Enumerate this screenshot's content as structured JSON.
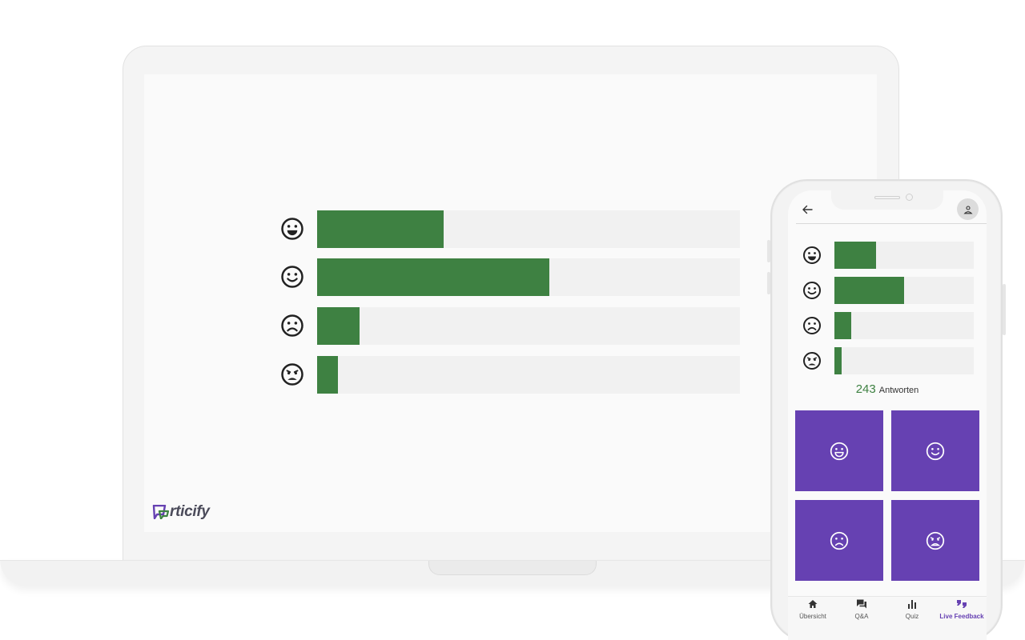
{
  "laptop": {
    "brand": {
      "text": "rticify",
      "mark_color": "#6641b2",
      "accent_color": "#3e8142"
    },
    "feedback": [
      {
        "mood": "very-happy",
        "icon": "laughing-face-icon",
        "fraction": 0.3
      },
      {
        "mood": "happy",
        "icon": "smiling-face-icon",
        "fraction": 0.55
      },
      {
        "mood": "sad",
        "icon": "frowning-face-icon",
        "fraction": 0.1
      },
      {
        "mood": "very-sad",
        "icon": "angry-face-icon",
        "fraction": 0.05
      }
    ]
  },
  "phone": {
    "topbar": {
      "back_icon": "arrow-left-icon",
      "avatar_icon": "person-icon"
    },
    "feedback": [
      {
        "mood": "very-happy",
        "icon": "laughing-face-icon",
        "fraction": 0.3
      },
      {
        "mood": "happy",
        "icon": "smiling-face-icon",
        "fraction": 0.5
      },
      {
        "mood": "sad",
        "icon": "frowning-face-icon",
        "fraction": 0.12
      },
      {
        "mood": "very-sad",
        "icon": "angry-face-icon",
        "fraction": 0.05
      }
    ],
    "responses": {
      "count": "243",
      "label": "Antworten"
    },
    "vote_buttons": [
      {
        "mood": "very-happy",
        "icon": "laughing-face-icon"
      },
      {
        "mood": "happy",
        "icon": "smiling-face-icon"
      },
      {
        "mood": "sad",
        "icon": "frowning-face-icon"
      },
      {
        "mood": "very-sad",
        "icon": "angry-face-icon"
      }
    ],
    "nav": [
      {
        "label": "Übersicht",
        "icon": "home-icon",
        "active": false
      },
      {
        "label": "Q&A",
        "icon": "chat-bubbles-icon",
        "active": false
      },
      {
        "label": "Quiz",
        "icon": "bar-chart-icon",
        "active": false
      },
      {
        "label": "Live Feedback",
        "icon": "quote-icon",
        "active": true
      }
    ]
  },
  "colors": {
    "bar_fill": "#3e8142",
    "bar_track": "#f1f1f1",
    "vote_button": "#6641b2",
    "active_nav": "#6641b2"
  }
}
